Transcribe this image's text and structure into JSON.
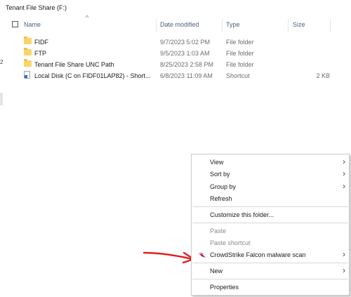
{
  "window": {
    "title": "Tenant File Share (F:)"
  },
  "nav": {
    "mark": "2"
  },
  "columns": {
    "name": "Name",
    "date": "Date modified",
    "type": "Type",
    "size": "Size"
  },
  "files": [
    {
      "name": "FIDF",
      "date": "9/7/2023 5:02 PM",
      "type": "File folder",
      "size": "",
      "icon": "folder-icon"
    },
    {
      "name": "FTP",
      "date": "9/5/2023 1:03 AM",
      "type": "File folder",
      "size": "",
      "icon": "folder-icon"
    },
    {
      "name": "Tenant File Share UNC Path",
      "date": "8/25/2023 2:58 PM",
      "type": "File folder",
      "size": "",
      "icon": "folder-icon"
    },
    {
      "name": "Local Disk (C on FIDF01LAP82) - Short...",
      "date": "6/8/2023 11:09 AM",
      "type": "Shortcut",
      "size": "2 KB",
      "icon": "shortcut-icon"
    }
  ],
  "context_menu": {
    "view": "View",
    "sort_by": "Sort by",
    "group_by": "Group by",
    "refresh": "Refresh",
    "customize": "Customize this folder...",
    "paste": "Paste",
    "paste_shortcut": "Paste shortcut",
    "crowdstrike": "CrowdStrike Falcon malware scan",
    "new": "New",
    "properties": "Properties"
  },
  "colors": {
    "annotation_arrow": "#e02020",
    "folder": "#f7d56b",
    "header_text": "#4c607a"
  },
  "glyphs": {
    "submenu": "›",
    "sort_up": "^"
  }
}
